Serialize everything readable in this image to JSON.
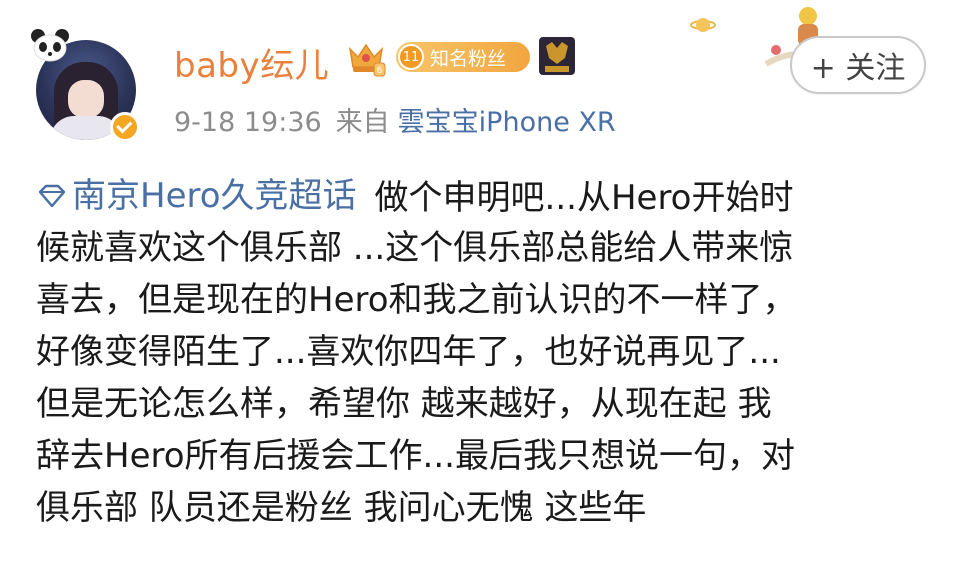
{
  "user": {
    "name": "baby纭儿",
    "time": "9-18 19:36",
    "source_prefix": "来自",
    "source": "雲宝宝iPhone XR"
  },
  "badges": {
    "fans_level": "11",
    "fans_label": "知名粉丝"
  },
  "follow_label": "+ 关注",
  "post": {
    "topic": "南京Hero久竞超话",
    "lines": [
      "做个申明吧...从Hero开始时",
      "候就喜欢这个俱乐部 ...这个俱乐部总能给人带来惊",
      "喜去，但是现在的Hero和我之前认识的不一样了，",
      "好像变得陌生了...喜欢你四年了，也好说再见了...",
      "但是无论怎么样，希望你 越来越好，从现在起 我",
      "辞去Hero所有后援会工作...最后我只想说一句，对",
      "俱乐部 队员还是粉丝 我问心无愧 这些年"
    ]
  },
  "colors": {
    "username": "#e9813d",
    "link": "#4a6fa5",
    "meta": "#8c8c8c",
    "badge": "#f1a640",
    "verified": "#f5a623"
  },
  "icons": [
    "panda-icon",
    "verified-icon",
    "crown-level-icon",
    "hero-team-logo-icon",
    "diamond-topic-icon",
    "planet-sticker-icon"
  ]
}
